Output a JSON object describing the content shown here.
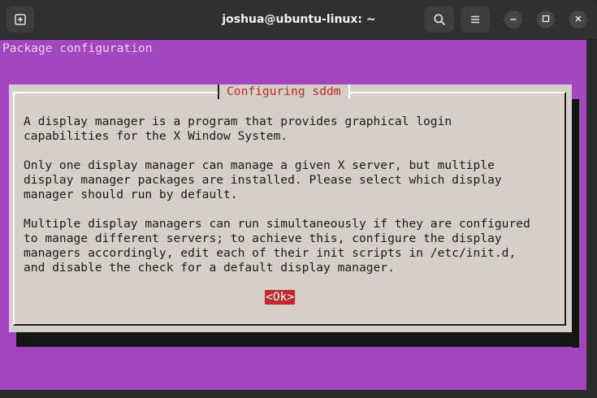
{
  "window": {
    "title": "joshua@ubuntu-linux: ~"
  },
  "terminal": {
    "header": "Package configuration"
  },
  "dialog": {
    "title": "Configuring sddm",
    "paragraphs": [
      "A display manager is a program that provides graphical login\ncapabilities for the X Window System.",
      "Only one display manager can manage a given X server, but multiple\ndisplay manager packages are installed. Please select which display\nmanager should run by default.",
      "Multiple display managers can run simultaneously if they are configured\nto manage different servers; to achieve this, configure the display\nmanagers accordingly, edit each of their init scripts in /etc/init.d,\nand disable the check for a default display manager."
    ],
    "ok_label": "<Ok>"
  },
  "icons": {
    "new_tab": "new-tab-icon",
    "search": "search-icon",
    "menu": "hamburger-menu-icon",
    "minimize": "minimize-icon",
    "maximize": "maximize-icon",
    "close": "close-icon"
  },
  "colors": {
    "terminal_bg": "#a245be",
    "dialog_bg": "#d4d0c8",
    "accent_red": "#c0282d",
    "titlebar_bg": "#303030"
  }
}
